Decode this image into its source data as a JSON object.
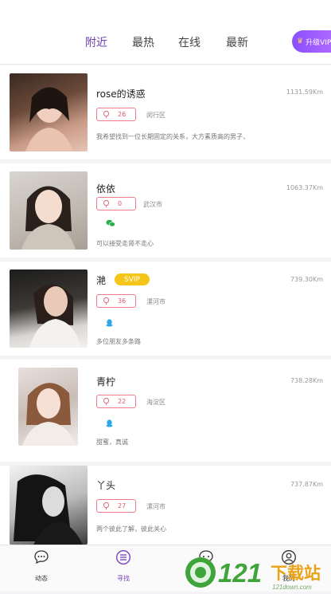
{
  "tabs": [
    {
      "label": "附近",
      "active": true
    },
    {
      "label": "最热",
      "active": false
    },
    {
      "label": "在线",
      "active": false
    },
    {
      "label": "最新",
      "active": false
    }
  ],
  "vip_button": {
    "label": "升级VIP",
    "icon": "crown-icon"
  },
  "profiles": [
    {
      "name": "rose的诱惑",
      "distance": "1131.59Km",
      "likes": "26",
      "location": "闵行区",
      "bio": "我希望找到一位长期固定的关系，大方素质高的男子，",
      "social_icon": ""
    },
    {
      "name": "依依",
      "distance": "1063.37Km",
      "likes": "0",
      "location": "武汉市",
      "bio": "可以接受走肾不走心",
      "social_icon": "wechat-icon"
    },
    {
      "name": "滟",
      "badge": "SVIP",
      "distance": "739.30Km",
      "likes": "36",
      "location": "漯河市",
      "bio": "多位朋友多条路",
      "social_icon": "qq-icon"
    },
    {
      "name": "青柠",
      "distance": "738.28Km",
      "likes": "22",
      "location": "海淀区",
      "bio": "甜蜜，真诚",
      "social_icon": "qq-icon"
    },
    {
      "name": "丫头",
      "distance": "737.87Km",
      "likes": "27",
      "location": "漯河市",
      "bio": "两个彼此了解，彼此关心",
      "social_icon": ""
    }
  ],
  "bottom_nav": [
    {
      "label": "动态",
      "icon": "chat-icon",
      "active": false
    },
    {
      "label": "寻找",
      "icon": "list-icon",
      "active": true
    },
    {
      "label": "",
      "icon": "message-icon",
      "active": false
    },
    {
      "label": "我的",
      "icon": "user-icon",
      "active": false
    }
  ],
  "watermark": {
    "text": "121下载站",
    "sub": "121down.com"
  },
  "colors": {
    "accent": "#6b3fb0",
    "likes_border": "#f07a8a",
    "svip": "#f5c518",
    "wechat": "#2aae4a",
    "qq": "#2ea8e8"
  }
}
